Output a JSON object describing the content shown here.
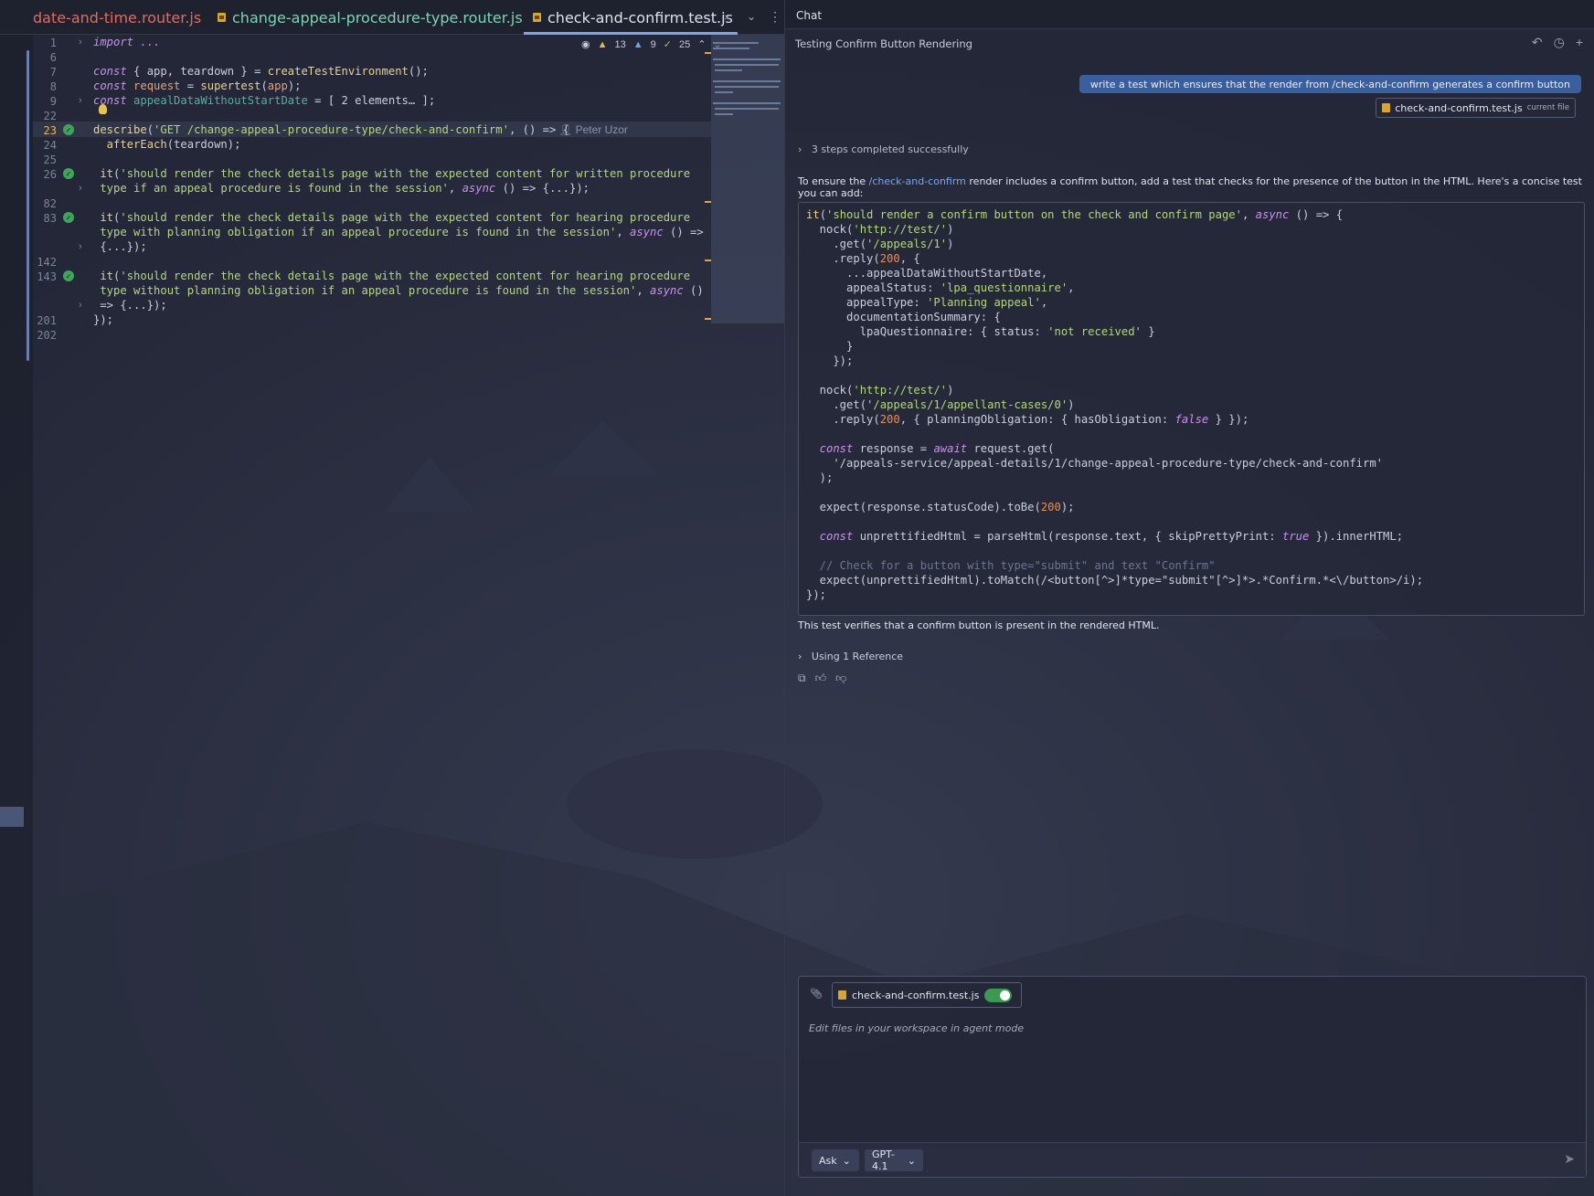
{
  "editor": {
    "tabs": [
      {
        "label": "date-and-time.router.js"
      },
      {
        "label": "change-appeal-procedure-type.router.js"
      },
      {
        "label": "check-and-confirm.test.js",
        "active": true
      }
    ],
    "tab_close": "×",
    "inspection": {
      "warnings": "13",
      "weak_warnings": "9",
      "ok": "25"
    },
    "author": "Peter Uzor",
    "line_numbers": [
      "1",
      "6",
      "7",
      "8",
      "9",
      "22",
      "23",
      "24",
      "25",
      "26",
      "",
      "82",
      "83",
      "",
      "",
      "142",
      "143",
      "",
      "",
      "201",
      "202"
    ],
    "lines": {
      "l1": "import ...",
      "l7a": "const",
      "l7b": " { app, teardown } = ",
      "l7c": "createTestEnvironment",
      "l7d": "();",
      "l8a": "const",
      "l8b": " request",
      "l8c": " = ",
      "l8d": "supertest",
      "l8e": "(",
      "l8f": "app",
      "l8g": ");",
      "l9a": "const",
      "l9b": " appealDataWithoutStartDate",
      "l9c": " = [ 2 elements… ];",
      "l23a": "describe",
      "l23b": "(",
      "l23c": "'GET /change-appeal-procedure-type/check-and-confirm'",
      "l23d": ", () => {",
      "l24a": "  afterEach",
      "l24b": "(teardown);",
      "l26a": " it",
      "l26b": "(",
      "l26c": "'should render the check details page with the expected content for written procedure",
      "l26d": " type if an appeal procedure is found in the session'",
      "l26e": ", ",
      "l26f": "async",
      "l26g": " () => {...});",
      "l83a": " it",
      "l83b": "(",
      "l83c": "'should render the check details page with the expected content for hearing procedure",
      "l83d": " type with planning obligation if an appeal procedure is found in the session'",
      "l83e": ", ",
      "l83f": "async",
      "l83g": " () =>",
      "l83h": " {...});",
      "l143a": " it",
      "l143b": "(",
      "l143c": "'should render the check details page with the expected content for hearing procedure",
      "l143d": " type without planning obligation if an appeal procedure is found in the session'",
      "l143e": ", ",
      "l143f": "async",
      "l143g": " ()",
      "l143h": " => {...});",
      "l201": "});"
    }
  },
  "chat": {
    "tab_label": "Chat",
    "title": "Testing Confirm Button Rendering",
    "user_message": "write a test which ensures that the render from /check-and-confirm generates a confirm button",
    "context_file": "check-and-confirm.test.js",
    "context_tag": "current file",
    "steps": "3 steps completed successfully",
    "intro_pre": "To ensure the ",
    "intro_hl": "/check-and-confirm",
    "intro_post": " render includes a confirm button, add a test that checks for the presence of the button in the HTML. Here's a concise test you can add:",
    "code": {
      "c1a": "it",
      "c1b": "(",
      "c1c": "'should render a confirm button on the check and confirm page'",
      "c1d": ", ",
      "c1e": "async",
      "c1f": " () => {",
      "c2a": "  nock(",
      "c2b": "'http://test/'",
      "c2c": ")",
      "c3a": "    .get(",
      "c3b": "'/appeals/1'",
      "c3c": ")",
      "c4a": "    .reply(",
      "c4b": "200",
      "c4c": ", {",
      "c5": "      ...appealDataWithoutStartDate,",
      "c6a": "      appealStatus: ",
      "c6b": "'lpa_questionnaire'",
      "c6c": ",",
      "c7a": "      appealType: ",
      "c7b": "'Planning appeal'",
      "c7c": ",",
      "c8": "      documentationSummary: {",
      "c9a": "        lpaQuestionnaire: { status: ",
      "c9b": "'not received'",
      "c9c": " }",
      "c10": "      }",
      "c11": "    });",
      "c13a": "  nock(",
      "c13b": "'http://test/'",
      "c13c": ")",
      "c14a": "    .get(",
      "c14b": "'/appeals/1/appellant-cases/0'",
      "c14c": ")",
      "c15a": "    .reply(",
      "c15b": "200",
      "c15c": ", { planningObligation: { hasObligation: ",
      "c15d": "false",
      "c15e": " } });",
      "c17a": "  const",
      "c17b": " response = ",
      "c17c": "await",
      "c17d": " request.get(",
      "c18": "    '/appeals-service/appeal-details/1/change-appeal-procedure-type/check-and-confirm'",
      "c19": "  );",
      "c21a": "  expect(response.statusCode).toBe(",
      "c21b": "200",
      "c21c": ");",
      "c23a": "  const",
      "c23b": " unprettifiedHtml = parseHtml(response.text, { skipPrettyPrint: ",
      "c23c": "true",
      "c23d": " }).innerHTML;",
      "c25": "  // Check for a button with type=\"submit\" and text \"Confirm\"",
      "c26": "  expect(unprettifiedHtml).toMatch(/<button[^>]*type=\"submit\"[^>]*>.*Confirm.*<\\/button>/i);",
      "c27": "});"
    },
    "summary": "This test verifies that a confirm button is present in the rendered HTML.",
    "reference": "Using 1 Reference",
    "input": {
      "file_chip": "check-and-confirm.test.js",
      "placeholder": "Edit files in your workspace in agent mode",
      "mode": "Ask",
      "model": "GPT-4.1"
    }
  },
  "colors": {
    "accent": "#3a5f9e",
    "keyword": "#c792ea",
    "string": "#b5d67a",
    "function": "#e7d48a",
    "number": "#f08d49"
  }
}
